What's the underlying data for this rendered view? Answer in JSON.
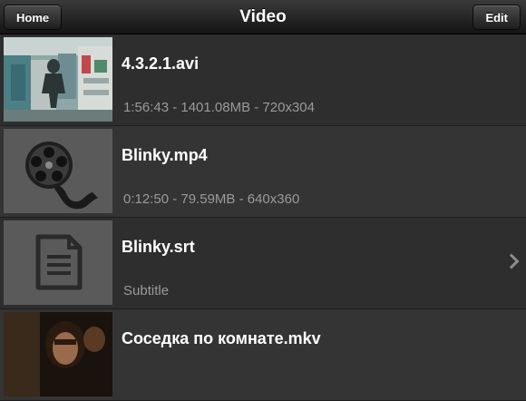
{
  "navbar": {
    "title": "Video",
    "home_label": "Home",
    "edit_label": "Edit"
  },
  "items": [
    {
      "title": "4.3.2.1.avi",
      "subtitle": "1:56:43 - 1401.08MB - 720x304",
      "thumbnail": "video-frame-store"
    },
    {
      "title": "Blinky.mp4",
      "subtitle": "0:12:50 - 79.59MB - 640x360",
      "thumbnail": "film-reel-icon"
    },
    {
      "title": "Blinky.srt",
      "subtitle": "Subtitle",
      "thumbnail": "document-icon"
    },
    {
      "title": "Соседка по комнате.mkv",
      "subtitle": "",
      "thumbnail": "video-frame-portrait"
    }
  ],
  "colors": {
    "background": "#2b2b2b",
    "navbar": "#1d1d1d",
    "title_text": "#ffffff",
    "subtitle_text": "#9a9a9a"
  }
}
